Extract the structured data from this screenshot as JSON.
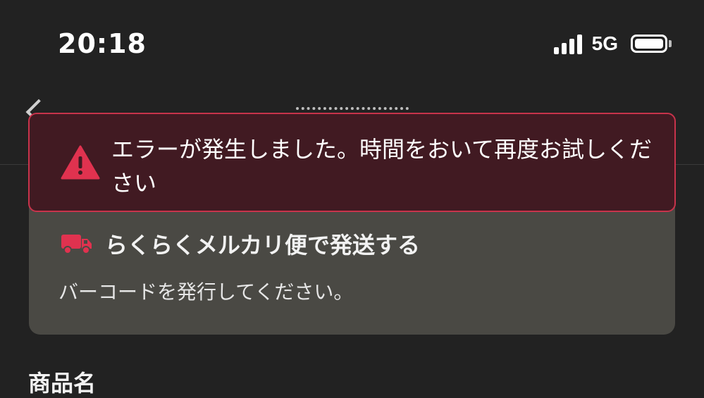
{
  "status_bar": {
    "time": "20:18",
    "network": "5G"
  },
  "error_toast": {
    "message": "エラーが発生しました。時間をおいて再度お試しください",
    "icon": "warning-icon",
    "accent_color": "#e0324f"
  },
  "shipping_card": {
    "icon": "truck-icon",
    "title": "らくらくメルカリ便で発送する",
    "description": "バーコードを発行してください。"
  },
  "section": {
    "label": "商品名"
  }
}
